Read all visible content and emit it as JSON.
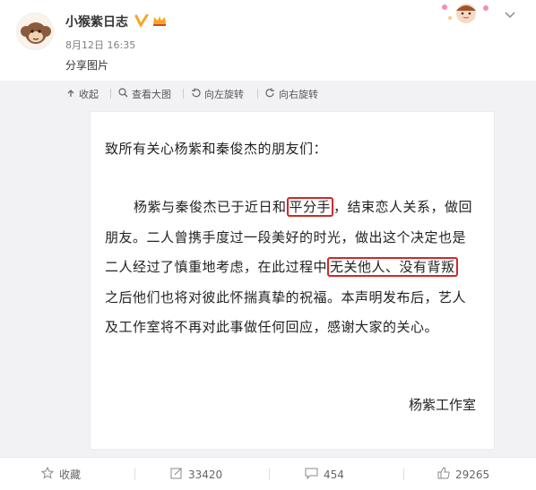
{
  "post": {
    "user_name": "小猴紫日志",
    "time": "8月12日 16:35",
    "text": "分享图片"
  },
  "toolbar": {
    "collapse": "收起",
    "view_large": "查看大图",
    "rotate_left": "向左旋转",
    "rotate_right": "向右旋转"
  },
  "document": {
    "greeting": "致所有关心杨紫和秦俊杰的朋友们：",
    "line1_a": "杨紫与秦俊杰已于近日和",
    "line1_hl": "平分手",
    "line1_b": "，结束恋人关系，做回",
    "line2": "朋友。二人曾携手度过一段美好的时光，做出这个决定也是",
    "line3_a": "二人经过了慎重地考虑，在此过程中",
    "line3_hl": "无关他人、没有背叛",
    "line4": "之后他们也将对彼此怀揣真挚的祝福。本声明发布后，艺人",
    "line5": "及工作室将不再对此事做任何回应，感谢大家的关心。",
    "signature": "杨紫工作室"
  },
  "footer": {
    "favorite": "收藏",
    "repost_count": "33420",
    "comment_count": "454",
    "like_count": "29265"
  },
  "colors": {
    "highlight_box": "#d0282a",
    "verified": "#f5a623",
    "media_bg": "#f2f2f5"
  },
  "icons": {
    "collapse": "arrow-up-icon",
    "view_large": "magnifier-icon",
    "rotate_left": "rotate-left-icon",
    "rotate_right": "rotate-right-icon",
    "favorite": "star-icon",
    "repost": "repost-icon",
    "comment": "comment-icon",
    "like": "thumbs-up-icon",
    "verified": "verified-v-icon",
    "vip": "vip-crown-icon",
    "dropdown": "chevron-down-icon"
  }
}
